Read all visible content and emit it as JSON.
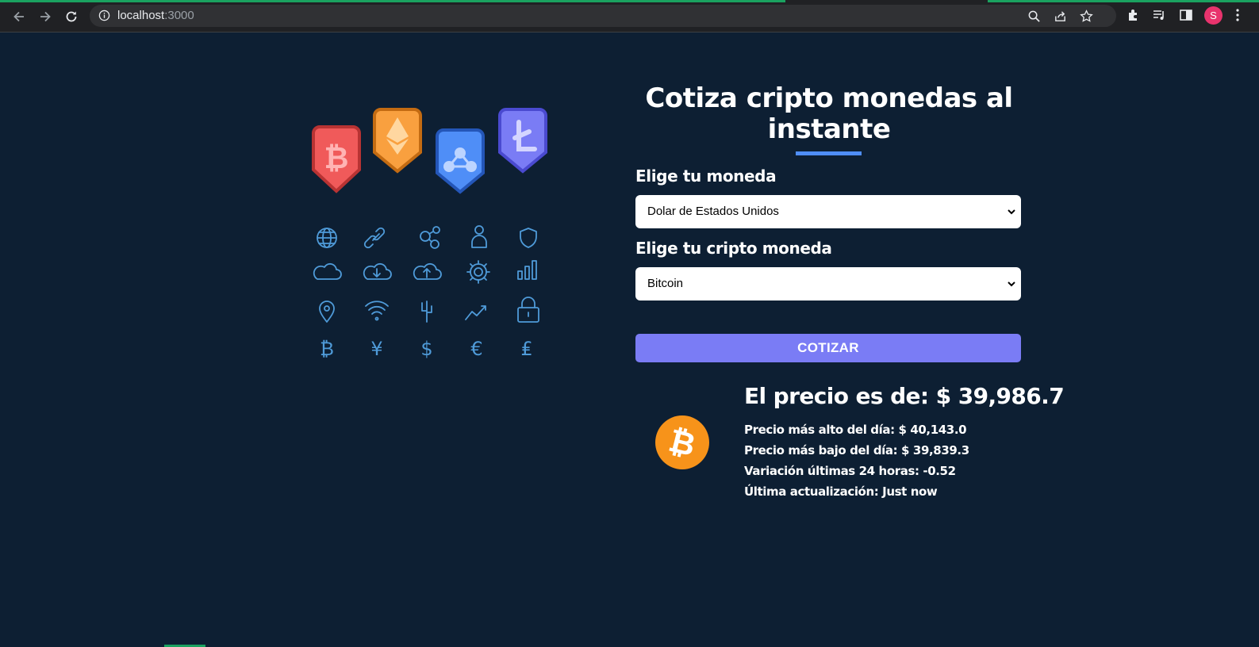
{
  "browser": {
    "url_host": "localhost",
    "url_port": ":3000",
    "avatar_letter": "S"
  },
  "heading": "Cotiza cripto monedas al instante",
  "form": {
    "currency_label": "Elige tu moneda",
    "currency_value": "Dolar de Estados Unidos",
    "crypto_label": "Elige tu cripto moneda",
    "crypto_value": "Bitcoin",
    "submit_label": "COTIZAR"
  },
  "result": {
    "price": "El precio es de: $ 39,986.7",
    "high": "Precio más alto del día: $ 40,143.0",
    "low": "Precio más bajo del día: $ 39,839.3",
    "change": "Variación últimas 24 horas: -0.52",
    "updated": "Última actualización: Just now"
  },
  "colors": {
    "background": "#0d1f33",
    "accent": "#4f8ef7",
    "button": "#7a7cf5",
    "bitcoin": "#f7931a"
  }
}
